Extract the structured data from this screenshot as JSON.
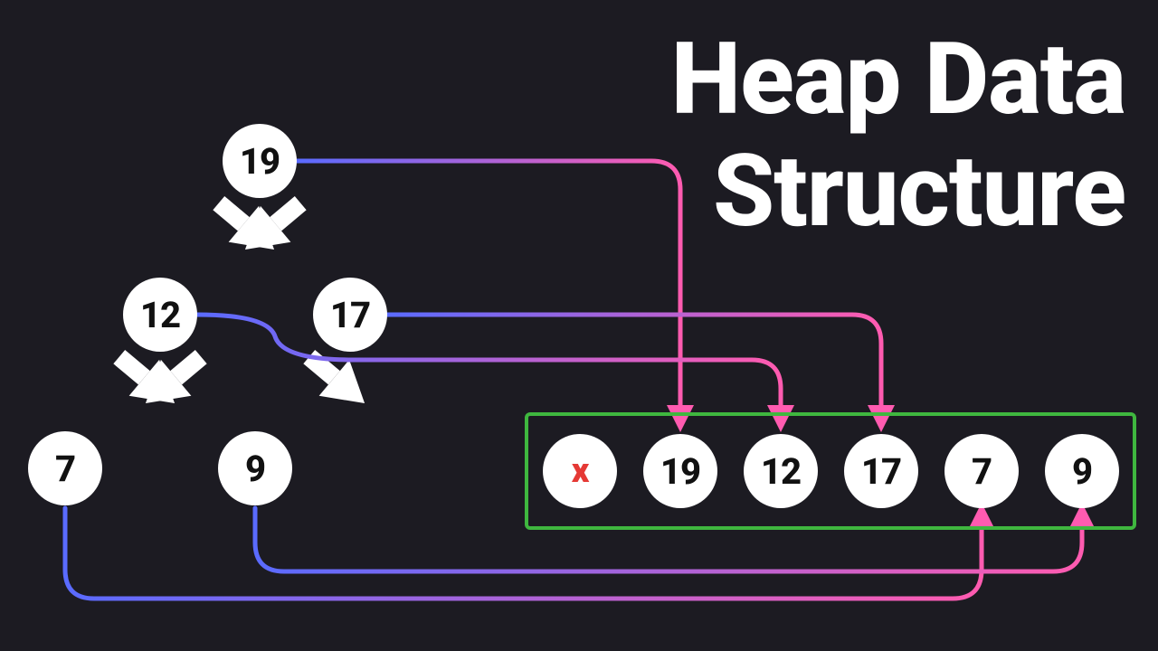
{
  "title": {
    "line1": "Heap Data",
    "line2": "Structure"
  },
  "tree_nodes": {
    "n19": "19",
    "n12": "12",
    "n17": "17",
    "n7": "7",
    "n9": "9"
  },
  "array_cells": {
    "c0": "x",
    "c1": "19",
    "c2": "12",
    "c3": "17",
    "c4": "7",
    "c5": "9"
  },
  "colors": {
    "background": "#1c1b22",
    "node_fill": "#ffffff",
    "node_text": "#111111",
    "placeholder_text": "#e53935",
    "array_border": "#3fb73f",
    "arrow_white": "#ffffff",
    "map_blue": "#5a6bff",
    "map_pink": "#ff5bb0"
  }
}
